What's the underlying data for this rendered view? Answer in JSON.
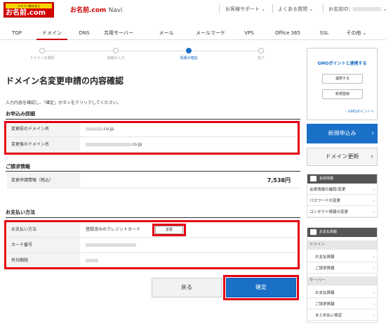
{
  "header": {
    "logo_tagline": "ドメイン取るなら",
    "logo_text": "お名前.com",
    "app_name": "お名前.com",
    "app_suffix": "Navi",
    "support": "お客様サポート",
    "faq": "よくある質問",
    "user_id_label": "お名前ID："
  },
  "gnav": [
    "TOP",
    "ドメイン",
    "DNS",
    "共用サーバー",
    "メール",
    "メールマーケ",
    "VPS",
    "Office 365",
    "SSL",
    "その他"
  ],
  "stepper": [
    "ドメインの選択",
    "情報の入力",
    "情報の確認",
    "完了"
  ],
  "main": {
    "title": "ドメイン名変更申請の内容確認",
    "instruction": "入力内容を確認し、「確定」ボタンをクリックしてください。",
    "order_section": "お申込み詳細",
    "order_rows": [
      {
        "label": "変更前のドメイン名",
        "value": ".co.jp"
      },
      {
        "label": "変更後のドメイン名",
        "value": ".co.jp"
      }
    ],
    "billing_section": "ご請求情報",
    "billing_label": "変更申請情報（税込）",
    "billing_amount": "7,538円",
    "payment_section": "お支払い方法",
    "payment_rows": [
      {
        "label": "お支払い方法",
        "value": "登録済みのクレジットカード"
      },
      {
        "label": "カード番号",
        "value": ""
      },
      {
        "label": "有効期限",
        "value": ""
      }
    ],
    "change_button": "変更",
    "back_button": "戻る",
    "confirm_button": "確定"
  },
  "sidebar": {
    "gmo_title": "GMOポイントと連携する",
    "link_button": "連携する",
    "register_button": "新規登録",
    "gmo_link": "GMOポイントへ",
    "new_apply": "新規申込み",
    "renew": "ドメイン更新",
    "member_head": "会員情報",
    "member_items": [
      "会員情報の確認/変更",
      "パスワードの変更",
      "コンタクト情報の変更"
    ],
    "payment_head": "お支払情報",
    "domain_group": "ドメイン",
    "domain_items": [
      "お支払情報",
      "ご請求情報"
    ],
    "server_group": "サーバー",
    "server_items": [
      "お支払情報",
      "ご請求情報",
      "まとめ払い設定"
    ]
  },
  "colors": {
    "accent": "#1a6fc7",
    "brand_red": "#d20000",
    "highlight": "#e60012"
  }
}
